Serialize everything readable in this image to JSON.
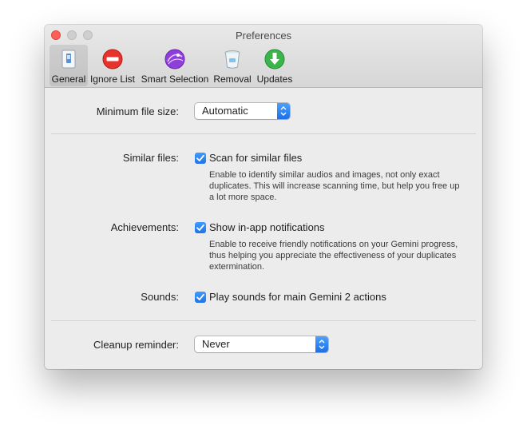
{
  "window": {
    "title": "Preferences"
  },
  "toolbar": {
    "items": [
      {
        "label": "General",
        "icon": "general-icon",
        "selected": true
      },
      {
        "label": "Ignore List",
        "icon": "no-entry-icon",
        "selected": false
      },
      {
        "label": "Smart Selection",
        "icon": "smart-selection-icon",
        "selected": false
      },
      {
        "label": "Removal",
        "icon": "trash-icon",
        "selected": false
      },
      {
        "label": "Updates",
        "icon": "download-arrow-icon",
        "selected": false
      }
    ]
  },
  "settings": {
    "min_file_size": {
      "label": "Minimum file size:",
      "value": "Automatic"
    },
    "similar_files": {
      "label": "Similar files:",
      "checkbox_label": "Scan for similar files",
      "checked": true,
      "description": "Enable to identify similar audios and images, not only exact duplicates. This will increase scanning time, but help you free up a lot more space."
    },
    "achievements": {
      "label": "Achievements:",
      "checkbox_label": "Show in-app notifications",
      "checked": true,
      "description": "Enable to receive friendly notifications on your Gemini progress, thus helping you appreciate the effectiveness of your duplicates extermination."
    },
    "sounds": {
      "label": "Sounds:",
      "checkbox_label": "Play sounds for main Gemini 2 actions",
      "checked": true
    },
    "cleanup_reminder": {
      "label": "Cleanup reminder:",
      "value": "Never"
    }
  },
  "colors": {
    "accent": "#1f74e8",
    "close": "#fc5f57"
  }
}
